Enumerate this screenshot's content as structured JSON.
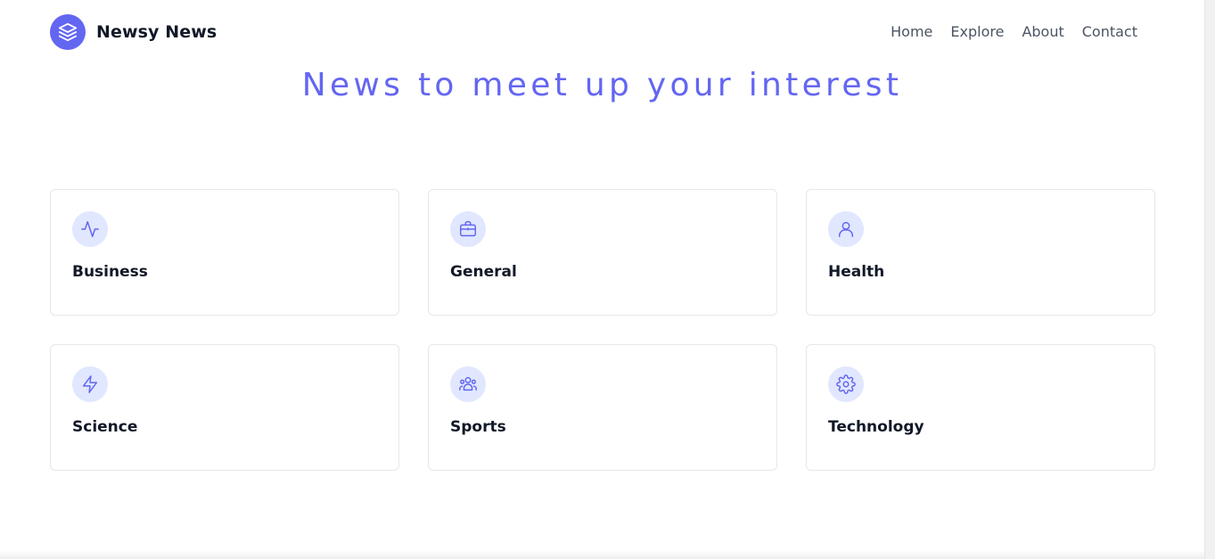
{
  "brand": {
    "name": "Newsy News",
    "logo_icon": "layers-icon",
    "accent_color": "#6366f1"
  },
  "nav": {
    "items": [
      "Home",
      "Explore",
      "About",
      "Contact"
    ]
  },
  "hero": {
    "title": "News to meet up your interest"
  },
  "categories": [
    {
      "label": "Business",
      "icon": "activity-icon"
    },
    {
      "label": "General",
      "icon": "briefcase-icon"
    },
    {
      "label": "Health",
      "icon": "user-icon"
    },
    {
      "label": "Science",
      "icon": "lightning-icon"
    },
    {
      "label": "Sports",
      "icon": "team-icon"
    },
    {
      "label": "Technology",
      "icon": "gear-icon"
    }
  ]
}
